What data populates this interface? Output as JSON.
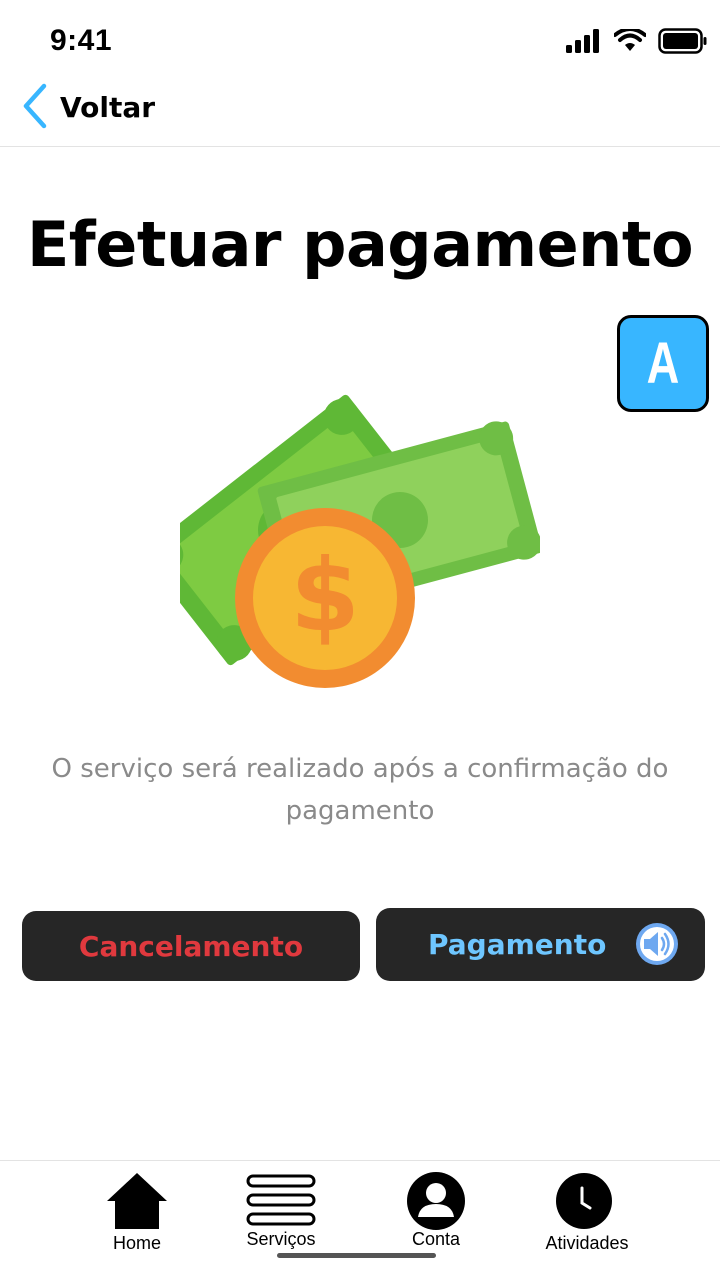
{
  "status_bar": {
    "time": "9:41"
  },
  "header": {
    "back_label": "Voltar",
    "back_icon": "chevron-left-icon"
  },
  "page": {
    "title": "Efetuar pagamento",
    "accessibility_badge": "A",
    "description": "O serviço será realizado após a confirmação do pagamento"
  },
  "actions": {
    "cancel_label": "Cancelamento",
    "pay_label": "Pagamento",
    "pay_icon": "speaker-icon"
  },
  "bottom_nav": {
    "items": [
      {
        "label": "Home",
        "icon": "home-icon"
      },
      {
        "label": "Serviços",
        "icon": "menu-icon"
      },
      {
        "label": "Conta",
        "icon": "user-icon"
      },
      {
        "label": "Atividades",
        "icon": "clock-icon"
      }
    ]
  },
  "colors": {
    "accent_blue": "#38b6ff",
    "cancel_red": "#e0393e",
    "pay_blue": "#6ec6ff",
    "button_dark": "#262626",
    "description_gray": "#8a8a8a"
  }
}
